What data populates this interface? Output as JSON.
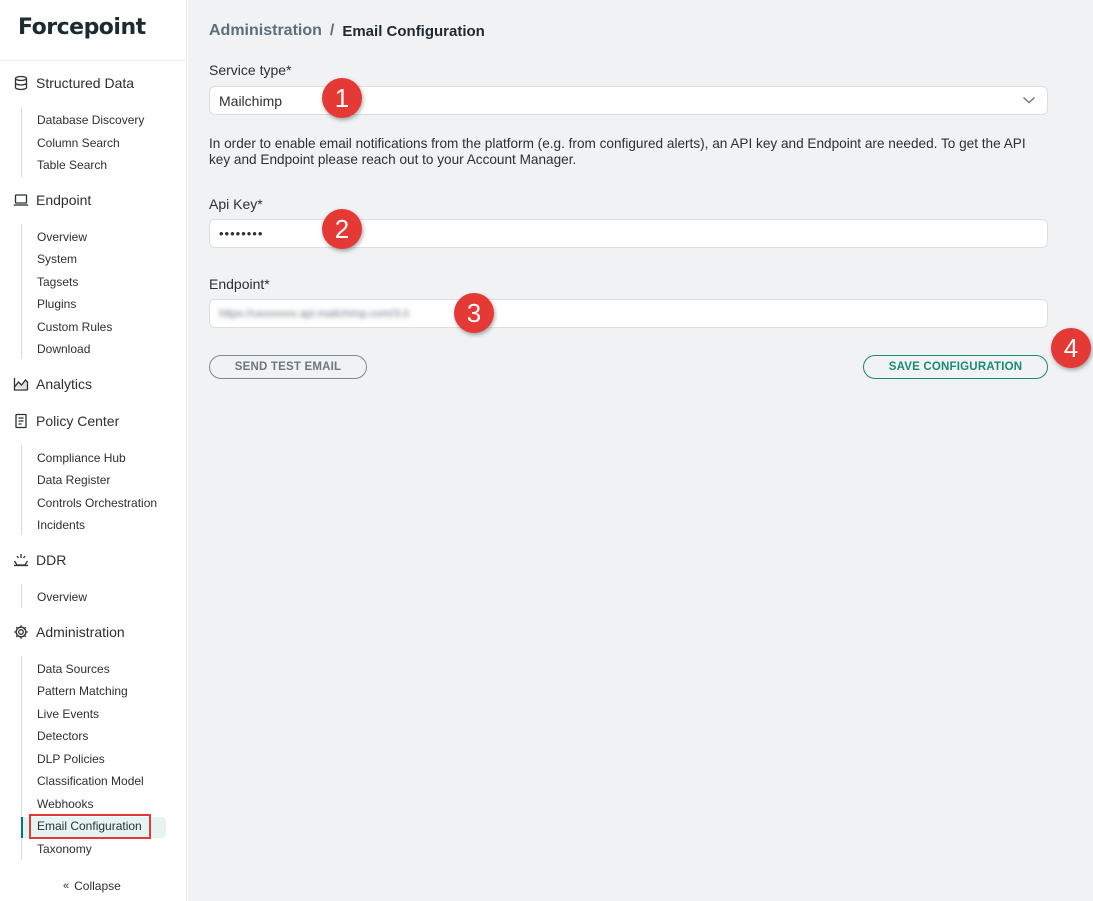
{
  "brand": {
    "logo_text": "Forcepoint"
  },
  "sidebar": {
    "sections": [
      {
        "label": "Structured Data",
        "icon": "database-icon",
        "items": [
          "Database Discovery",
          "Column Search",
          "Table Search"
        ]
      },
      {
        "label": "Endpoint",
        "icon": "laptop-icon",
        "items": [
          "Overview",
          "System",
          "Tagsets",
          "Plugins",
          "Custom Rules",
          "Download"
        ]
      },
      {
        "label": "Analytics",
        "icon": "analytics-icon",
        "items": []
      },
      {
        "label": "Policy Center",
        "icon": "document-icon",
        "items": [
          "Compliance Hub",
          "Data Register",
          "Controls Orchestration",
          "Incidents"
        ]
      },
      {
        "label": "DDR",
        "icon": "ddr-icon",
        "items": [
          "Overview"
        ]
      },
      {
        "label": "Administration",
        "icon": "gear-icon",
        "items": [
          "Data Sources",
          "Pattern Matching",
          "Live Events",
          "Detectors",
          "DLP Policies",
          "Classification Model",
          "Webhooks",
          "Email Configuration",
          "Taxonomy"
        ]
      }
    ],
    "active_item": "Email Configuration",
    "collapse_label": "Collapse"
  },
  "breadcrumb": {
    "parent": "Administration",
    "separator": "/",
    "current": "Email Configuration"
  },
  "form": {
    "service_type_label": "Service type*",
    "service_type_value": "Mailchimp",
    "help_text": "In order to enable email notifications from the platform (e.g. from configured alerts), an API key and Endpoint are needed. To get the API key and Endpoint please reach out to your Account Manager.",
    "api_key_label": "Api Key*",
    "api_key_value": "••••••••",
    "endpoint_label": "Endpoint*",
    "endpoint_value": "https://usxxxxxx.api.mailchimp.com/3.0"
  },
  "buttons": {
    "send_test": "SEND TEST EMAIL",
    "save": "SAVE CONFIGURATION"
  },
  "annotations": [
    "1",
    "2",
    "3",
    "4"
  ],
  "colors": {
    "accent": "#1b8a74",
    "badge": "#e53935",
    "active_bg": "#e6f4f1"
  }
}
